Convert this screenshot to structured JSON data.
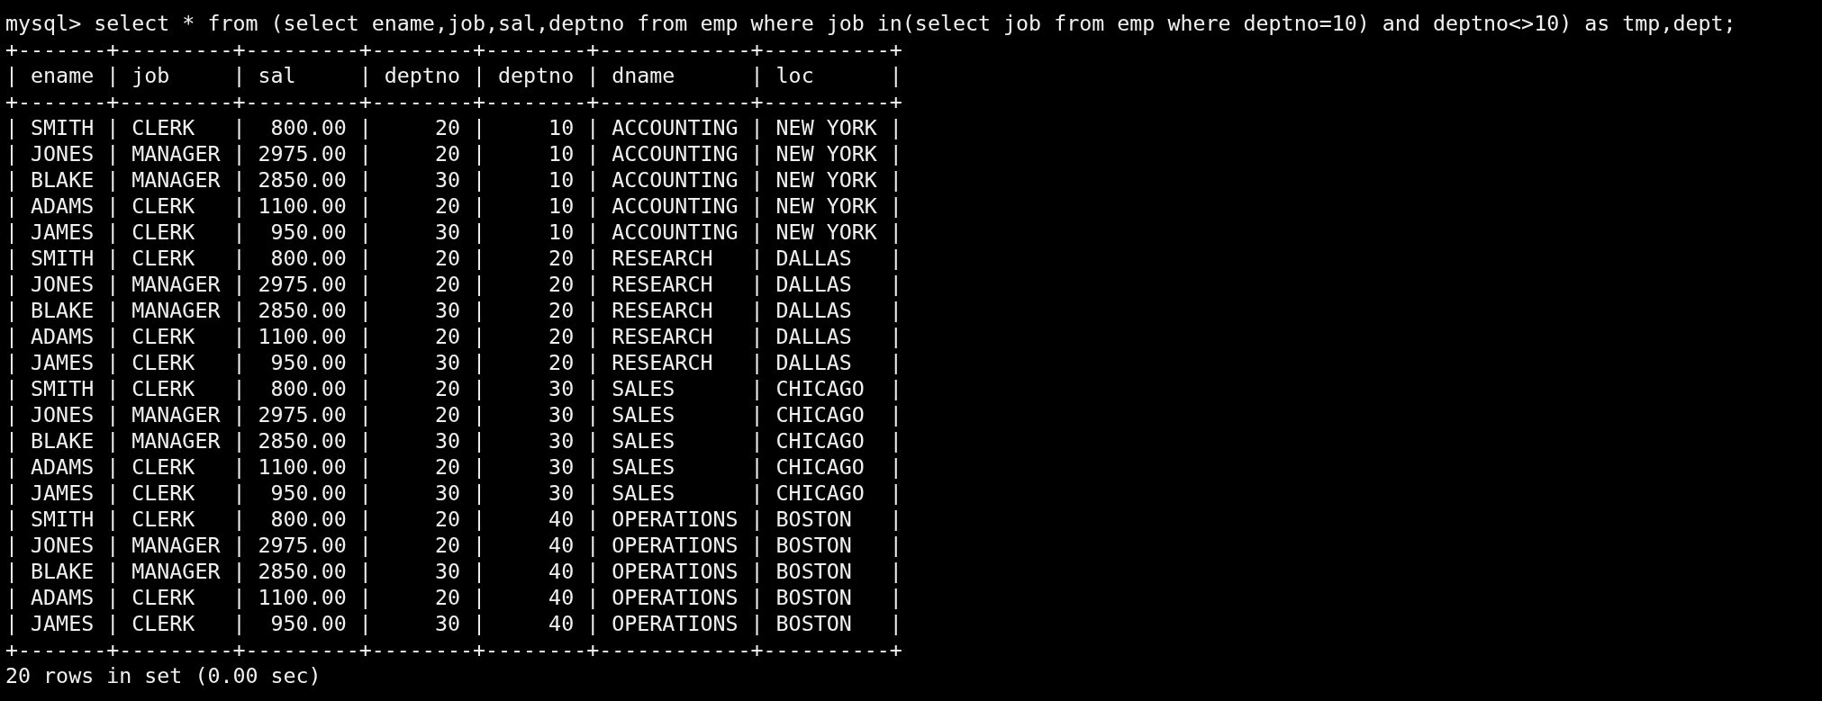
{
  "command": "mysql> select * from (select ename,job,sal,deptno from emp where job in(select job from emp where deptno=10) and deptno<>10) as tmp,dept;",
  "table": {
    "border_top": "+-------+---------+---------+--------+--------+------------+----------+",
    "header": "| ename | job     | sal     | deptno | deptno | dname      | loc      |",
    "border_mid": "+-------+---------+---------+--------+--------+------------+----------+",
    "rows": [
      "| SMITH | CLERK   |  800.00 |     20 |     10 | ACCOUNTING | NEW YORK |",
      "| JONES | MANAGER | 2975.00 |     20 |     10 | ACCOUNTING | NEW YORK |",
      "| BLAKE | MANAGER | 2850.00 |     30 |     10 | ACCOUNTING | NEW YORK |",
      "| ADAMS | CLERK   | 1100.00 |     20 |     10 | ACCOUNTING | NEW YORK |",
      "| JAMES | CLERK   |  950.00 |     30 |     10 | ACCOUNTING | NEW YORK |",
      "| SMITH | CLERK   |  800.00 |     20 |     20 | RESEARCH   | DALLAS   |",
      "| JONES | MANAGER | 2975.00 |     20 |     20 | RESEARCH   | DALLAS   |",
      "| BLAKE | MANAGER | 2850.00 |     30 |     20 | RESEARCH   | DALLAS   |",
      "| ADAMS | CLERK   | 1100.00 |     20 |     20 | RESEARCH   | DALLAS   |",
      "| JAMES | CLERK   |  950.00 |     30 |     20 | RESEARCH   | DALLAS   |",
      "| SMITH | CLERK   |  800.00 |     20 |     30 | SALES      | CHICAGO  |",
      "| JONES | MANAGER | 2975.00 |     20 |     30 | SALES      | CHICAGO  |",
      "| BLAKE | MANAGER | 2850.00 |     30 |     30 | SALES      | CHICAGO  |",
      "| ADAMS | CLERK   | 1100.00 |     20 |     30 | SALES      | CHICAGO  |",
      "| JAMES | CLERK   |  950.00 |     30 |     30 | SALES      | CHICAGO  |",
      "| SMITH | CLERK   |  800.00 |     20 |     40 | OPERATIONS | BOSTON   |",
      "| JONES | MANAGER | 2975.00 |     20 |     40 | OPERATIONS | BOSTON   |",
      "| BLAKE | MANAGER | 2850.00 |     30 |     40 | OPERATIONS | BOSTON   |",
      "| ADAMS | CLERK   | 1100.00 |     20 |     40 | OPERATIONS | BOSTON   |",
      "| JAMES | CLERK   |  950.00 |     30 |     40 | OPERATIONS | BOSTON   |"
    ],
    "border_bottom": "+-------+---------+---------+--------+--------+------------+----------+"
  },
  "status": "20 rows in set (0.00 sec)"
}
